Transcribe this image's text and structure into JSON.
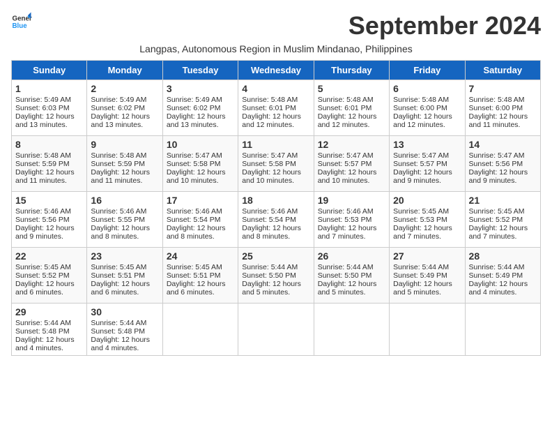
{
  "logo": {
    "line1": "General",
    "line2": "Blue"
  },
  "title": "September 2024",
  "subtitle": "Langpas, Autonomous Region in Muslim Mindanao, Philippines",
  "days_of_week": [
    "Sunday",
    "Monday",
    "Tuesday",
    "Wednesday",
    "Thursday",
    "Friday",
    "Saturday"
  ],
  "weeks": [
    [
      {
        "day": "1",
        "lines": [
          "Sunrise: 5:49 AM",
          "Sunset: 6:03 PM",
          "Daylight: 12 hours",
          "and 13 minutes."
        ]
      },
      {
        "day": "2",
        "lines": [
          "Sunrise: 5:49 AM",
          "Sunset: 6:02 PM",
          "Daylight: 12 hours",
          "and 13 minutes."
        ]
      },
      {
        "day": "3",
        "lines": [
          "Sunrise: 5:49 AM",
          "Sunset: 6:02 PM",
          "Daylight: 12 hours",
          "and 13 minutes."
        ]
      },
      {
        "day": "4",
        "lines": [
          "Sunrise: 5:48 AM",
          "Sunset: 6:01 PM",
          "Daylight: 12 hours",
          "and 12 minutes."
        ]
      },
      {
        "day": "5",
        "lines": [
          "Sunrise: 5:48 AM",
          "Sunset: 6:01 PM",
          "Daylight: 12 hours",
          "and 12 minutes."
        ]
      },
      {
        "day": "6",
        "lines": [
          "Sunrise: 5:48 AM",
          "Sunset: 6:00 PM",
          "Daylight: 12 hours",
          "and 12 minutes."
        ]
      },
      {
        "day": "7",
        "lines": [
          "Sunrise: 5:48 AM",
          "Sunset: 6:00 PM",
          "Daylight: 12 hours",
          "and 11 minutes."
        ]
      }
    ],
    [
      {
        "day": "8",
        "lines": [
          "Sunrise: 5:48 AM",
          "Sunset: 5:59 PM",
          "Daylight: 12 hours",
          "and 11 minutes."
        ]
      },
      {
        "day": "9",
        "lines": [
          "Sunrise: 5:48 AM",
          "Sunset: 5:59 PM",
          "Daylight: 12 hours",
          "and 11 minutes."
        ]
      },
      {
        "day": "10",
        "lines": [
          "Sunrise: 5:47 AM",
          "Sunset: 5:58 PM",
          "Daylight: 12 hours",
          "and 10 minutes."
        ]
      },
      {
        "day": "11",
        "lines": [
          "Sunrise: 5:47 AM",
          "Sunset: 5:58 PM",
          "Daylight: 12 hours",
          "and 10 minutes."
        ]
      },
      {
        "day": "12",
        "lines": [
          "Sunrise: 5:47 AM",
          "Sunset: 5:57 PM",
          "Daylight: 12 hours",
          "and 10 minutes."
        ]
      },
      {
        "day": "13",
        "lines": [
          "Sunrise: 5:47 AM",
          "Sunset: 5:57 PM",
          "Daylight: 12 hours",
          "and 9 minutes."
        ]
      },
      {
        "day": "14",
        "lines": [
          "Sunrise: 5:47 AM",
          "Sunset: 5:56 PM",
          "Daylight: 12 hours",
          "and 9 minutes."
        ]
      }
    ],
    [
      {
        "day": "15",
        "lines": [
          "Sunrise: 5:46 AM",
          "Sunset: 5:56 PM",
          "Daylight: 12 hours",
          "and 9 minutes."
        ]
      },
      {
        "day": "16",
        "lines": [
          "Sunrise: 5:46 AM",
          "Sunset: 5:55 PM",
          "Daylight: 12 hours",
          "and 8 minutes."
        ]
      },
      {
        "day": "17",
        "lines": [
          "Sunrise: 5:46 AM",
          "Sunset: 5:54 PM",
          "Daylight: 12 hours",
          "and 8 minutes."
        ]
      },
      {
        "day": "18",
        "lines": [
          "Sunrise: 5:46 AM",
          "Sunset: 5:54 PM",
          "Daylight: 12 hours",
          "and 8 minutes."
        ]
      },
      {
        "day": "19",
        "lines": [
          "Sunrise: 5:46 AM",
          "Sunset: 5:53 PM",
          "Daylight: 12 hours",
          "and 7 minutes."
        ]
      },
      {
        "day": "20",
        "lines": [
          "Sunrise: 5:45 AM",
          "Sunset: 5:53 PM",
          "Daylight: 12 hours",
          "and 7 minutes."
        ]
      },
      {
        "day": "21",
        "lines": [
          "Sunrise: 5:45 AM",
          "Sunset: 5:52 PM",
          "Daylight: 12 hours",
          "and 7 minutes."
        ]
      }
    ],
    [
      {
        "day": "22",
        "lines": [
          "Sunrise: 5:45 AM",
          "Sunset: 5:52 PM",
          "Daylight: 12 hours",
          "and 6 minutes."
        ]
      },
      {
        "day": "23",
        "lines": [
          "Sunrise: 5:45 AM",
          "Sunset: 5:51 PM",
          "Daylight: 12 hours",
          "and 6 minutes."
        ]
      },
      {
        "day": "24",
        "lines": [
          "Sunrise: 5:45 AM",
          "Sunset: 5:51 PM",
          "Daylight: 12 hours",
          "and 6 minutes."
        ]
      },
      {
        "day": "25",
        "lines": [
          "Sunrise: 5:44 AM",
          "Sunset: 5:50 PM",
          "Daylight: 12 hours",
          "and 5 minutes."
        ]
      },
      {
        "day": "26",
        "lines": [
          "Sunrise: 5:44 AM",
          "Sunset: 5:50 PM",
          "Daylight: 12 hours",
          "and 5 minutes."
        ]
      },
      {
        "day": "27",
        "lines": [
          "Sunrise: 5:44 AM",
          "Sunset: 5:49 PM",
          "Daylight: 12 hours",
          "and 5 minutes."
        ]
      },
      {
        "day": "28",
        "lines": [
          "Sunrise: 5:44 AM",
          "Sunset: 5:49 PM",
          "Daylight: 12 hours",
          "and 4 minutes."
        ]
      }
    ],
    [
      {
        "day": "29",
        "lines": [
          "Sunrise: 5:44 AM",
          "Sunset: 5:48 PM",
          "Daylight: 12 hours",
          "and 4 minutes."
        ]
      },
      {
        "day": "30",
        "lines": [
          "Sunrise: 5:44 AM",
          "Sunset: 5:48 PM",
          "Daylight: 12 hours",
          "and 4 minutes."
        ]
      },
      null,
      null,
      null,
      null,
      null
    ]
  ]
}
